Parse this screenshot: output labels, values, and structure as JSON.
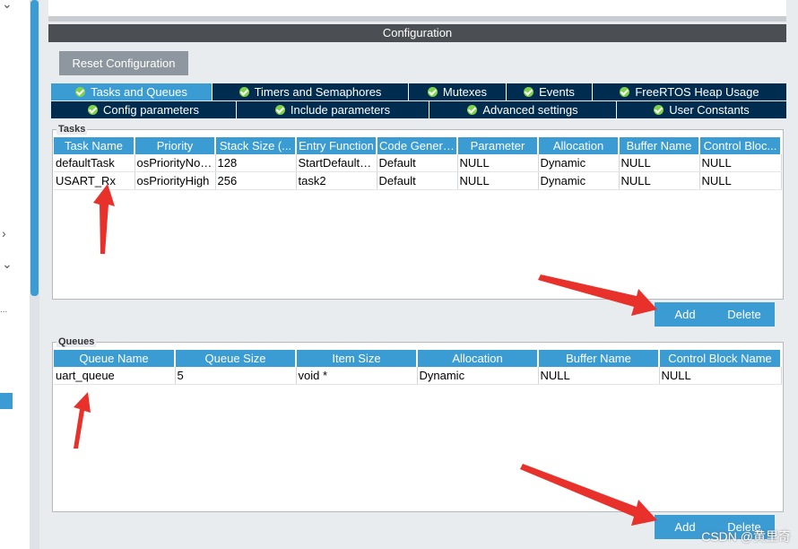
{
  "header": {
    "title": "Configuration"
  },
  "toolbar": {
    "reset_label": "Reset Configuration"
  },
  "tabs_row1": [
    {
      "label": "Tasks and Queues",
      "active": true
    },
    {
      "label": "Timers and Semaphores"
    },
    {
      "label": "Mutexes"
    },
    {
      "label": "Events"
    },
    {
      "label": "FreeRTOS Heap Usage"
    }
  ],
  "tabs_row2": [
    {
      "label": "Config parameters"
    },
    {
      "label": "Include parameters"
    },
    {
      "label": "Advanced settings"
    },
    {
      "label": "User Constants"
    }
  ],
  "tasks": {
    "group_label": "Tasks",
    "columns": [
      "Task Name",
      "Priority",
      "Stack Size (...",
      "Entry Function",
      "Code Genera...",
      "Parameter",
      "Allocation",
      "Buffer Name",
      "Control Bloc..."
    ],
    "rows": [
      [
        "defaultTask",
        "osPriorityNor...",
        "128",
        "StartDefaultT...",
        "Default",
        "NULL",
        "Dynamic",
        "NULL",
        "NULL"
      ],
      [
        "USART_Rx",
        "osPriorityHigh",
        "256",
        "task2",
        "Default",
        "NULL",
        "Dynamic",
        "NULL",
        "NULL"
      ]
    ],
    "add_label": "Add",
    "delete_label": "Delete"
  },
  "queues": {
    "group_label": "Queues",
    "columns": [
      "Queue Name",
      "Queue Size",
      "Item Size",
      "Allocation",
      "Buffer Name",
      "Control Block Name"
    ],
    "rows": [
      [
        "uart_queue",
        "5",
        "void *",
        "Dynamic",
        "NULL",
        "NULL"
      ]
    ],
    "add_label": "Add",
    "delete_label": "Delete"
  },
  "left_panel": {
    "chevron_right": "›",
    "chevron_down": "⌄",
    "ellipsis": "..."
  },
  "watermark": "CSDN @黄里奇",
  "colors": {
    "accent": "#3b9bd3",
    "tab_dark": "#002c4f",
    "header": "#4b4f54",
    "arrow": "#e8312b"
  }
}
